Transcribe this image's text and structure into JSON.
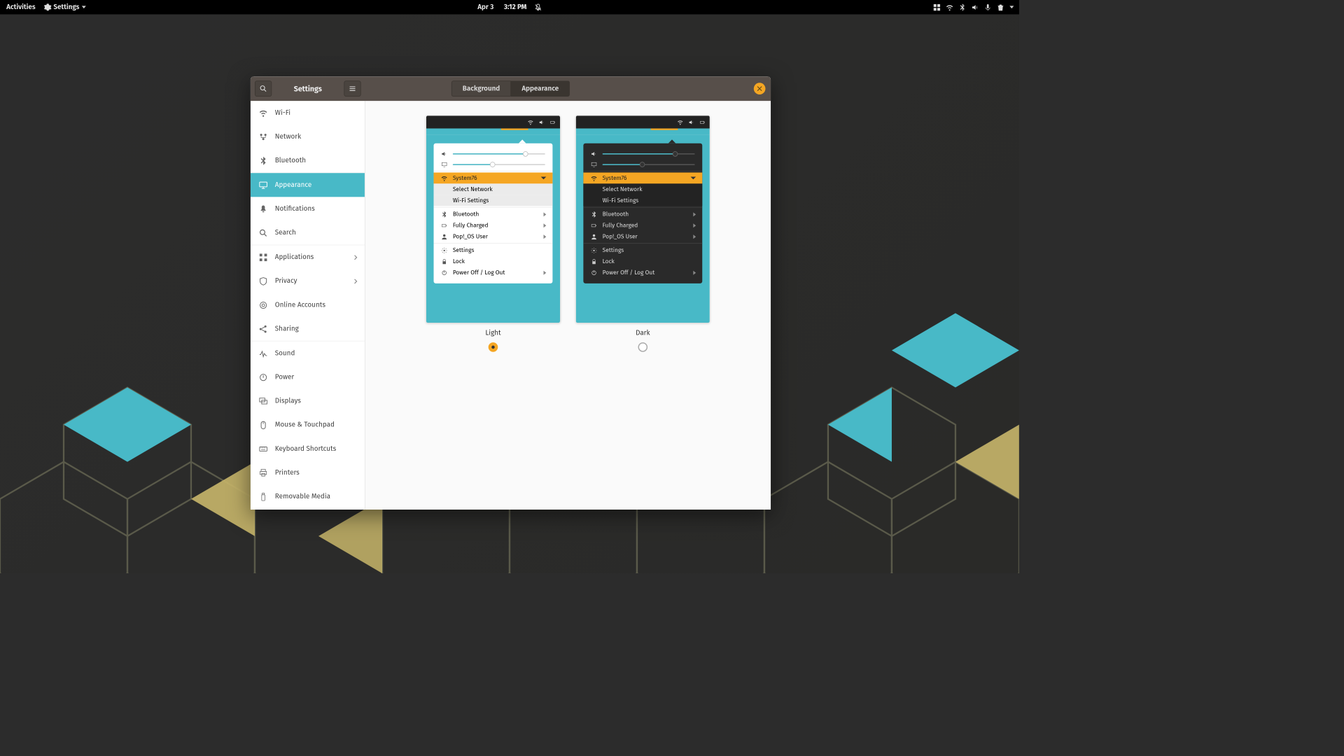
{
  "panel": {
    "activities": "Activities",
    "app_name": "Settings",
    "date": "Apr 3",
    "time": "3:12 PM"
  },
  "window": {
    "title": "Settings",
    "tabs": {
      "background": "Background",
      "appearance": "Appearance"
    }
  },
  "sidebar": {
    "wifi": "Wi-Fi",
    "network": "Network",
    "bluetooth": "Bluetooth",
    "appearance": "Appearance",
    "notifications": "Notifications",
    "search": "Search",
    "applications": "Applications",
    "privacy": "Privacy",
    "online_accounts": "Online Accounts",
    "sharing": "Sharing",
    "sound": "Sound",
    "power": "Power",
    "displays": "Displays",
    "mouse_touchpad": "Mouse & Touchpad",
    "keyboard_shortcuts": "Keyboard Shortcuts",
    "printers": "Printers",
    "removable_media": "Removable Media"
  },
  "themes": {
    "light": "Light",
    "dark": "Dark",
    "selected": "light"
  },
  "preview_menu": {
    "wifi_ssid": "System76",
    "select_network": "Select Network",
    "wifi_settings": "Wi-Fi Settings",
    "bluetooth": "Bluetooth",
    "battery": "Fully Charged",
    "user": "Pop!_OS User",
    "settings": "Settings",
    "lock": "Lock",
    "power_off": "Power Off / Log Out"
  }
}
